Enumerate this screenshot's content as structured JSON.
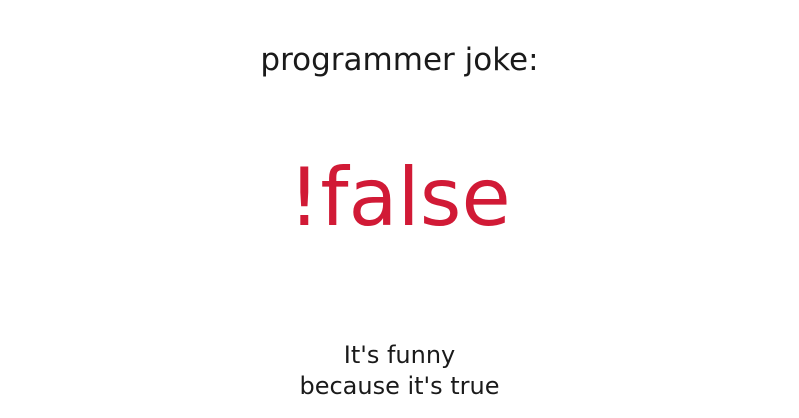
{
  "meme": {
    "heading": "programmer joke:",
    "punchline": "!false",
    "caption_lines": [
      "It's funny",
      "because it's true"
    ]
  },
  "colors": {
    "background": "#ffffff",
    "text": "#1a1a1a",
    "accent": "#d11a36"
  }
}
